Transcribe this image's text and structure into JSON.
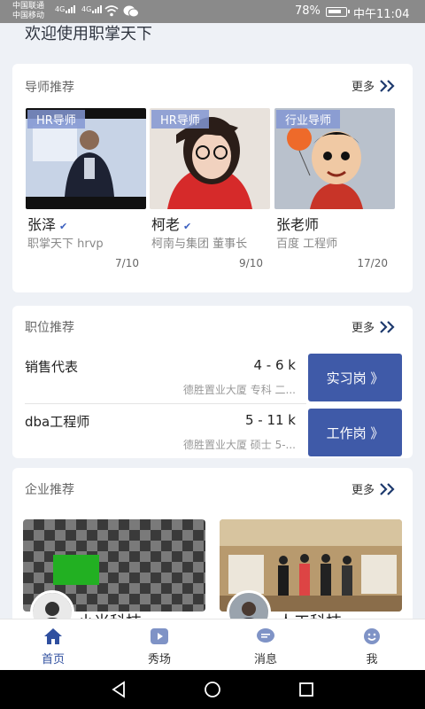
{
  "status_bar": {
    "carrier1": "中国联通",
    "carrier2": "中国移动",
    "net1": "4G",
    "net2": "4G",
    "battery": "78%",
    "time": "中午11:04"
  },
  "welcome": "欢迎使用职掌天下",
  "mentors": {
    "title": "导师推荐",
    "more": "更多",
    "items": [
      {
        "tag": "HR导师",
        "name": "张泽",
        "org": "职掌天下 hrvp",
        "count": "7/10"
      },
      {
        "tag": "HR导师",
        "name": "柯老",
        "org": "柯南与集团 董事长",
        "count": "9/10"
      },
      {
        "tag": "行业导师",
        "name": "张老师",
        "org": "百度 工程师",
        "count": "17/20"
      }
    ]
  },
  "jobs": {
    "title": "职位推荐",
    "more": "更多",
    "items": [
      {
        "title": "销售代表",
        "salary": "4 - 6 k",
        "meta": "德胜置业大厦 专科 二...",
        "button": "实习岗 》"
      },
      {
        "title": "dba工程师",
        "salary": "5 - 11 k",
        "meta": "德胜置业大厦 硕士 5-...",
        "button": "工作岗 》"
      }
    ]
  },
  "companies": {
    "title": "企业推荐",
    "more": "更多",
    "items": [
      {
        "name": "小米科技"
      },
      {
        "name": "人工科技"
      }
    ]
  },
  "nav": {
    "items": [
      {
        "label": "首页",
        "icon": "home-icon"
      },
      {
        "label": "秀场",
        "icon": "play-icon"
      },
      {
        "label": "消息",
        "icon": "message-icon"
      },
      {
        "label": "我",
        "icon": "smile-icon"
      }
    ]
  },
  "colors": {
    "accent": "#3f5aa8",
    "background": "#eef1f6",
    "status_bar": "#8a8a8a"
  }
}
